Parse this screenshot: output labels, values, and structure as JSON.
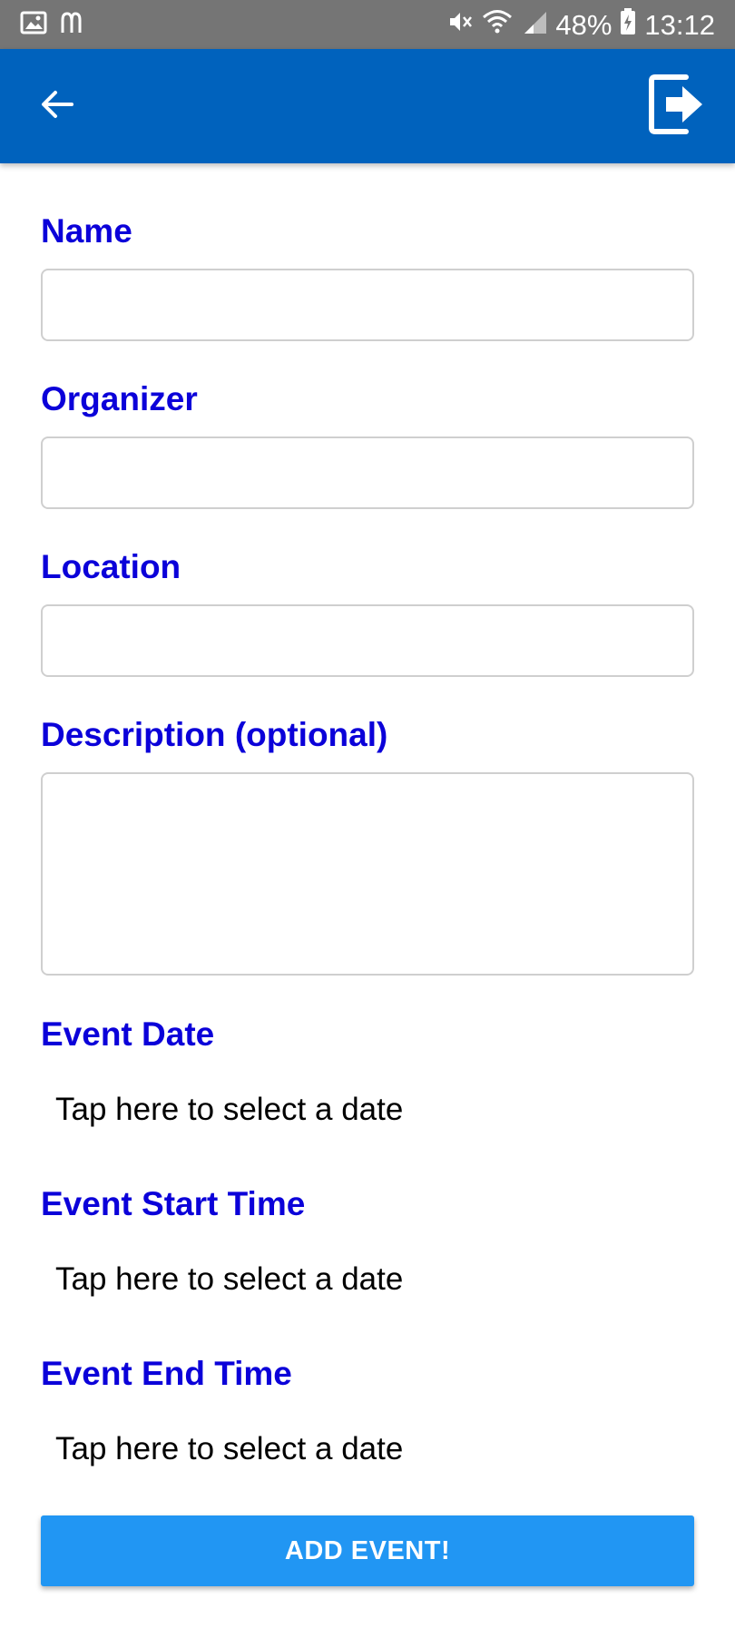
{
  "status_bar": {
    "left_icons": [
      "gallery-icon",
      "mcdonalds-icon"
    ],
    "right_icons": [
      "mute-icon",
      "wifi-icon",
      "signal-icon",
      "battery-icon"
    ],
    "battery": "48%",
    "time": "13:12"
  },
  "app_bar": {
    "background": "#0062bd",
    "back_icon": "arrow-left-icon",
    "exit_icon": "exit-icon"
  },
  "form": {
    "name_label": "Name",
    "name_value": "",
    "organizer_label": "Organizer",
    "organizer_value": "",
    "location_label": "Location",
    "location_value": "",
    "description_label": "Description (optional)",
    "description_value": "",
    "event_date_label": "Event Date",
    "event_date_value": "Tap here to select a date",
    "start_time_label": "Event Start Time",
    "start_time_value": "Tap here to select a date",
    "end_time_label": "Event End Time",
    "end_time_value": "Tap here to select a date",
    "label_color": "#0b00d9"
  },
  "actions": {
    "add_event_label": "ADD EVENT!",
    "button_color": "#2196f3"
  }
}
